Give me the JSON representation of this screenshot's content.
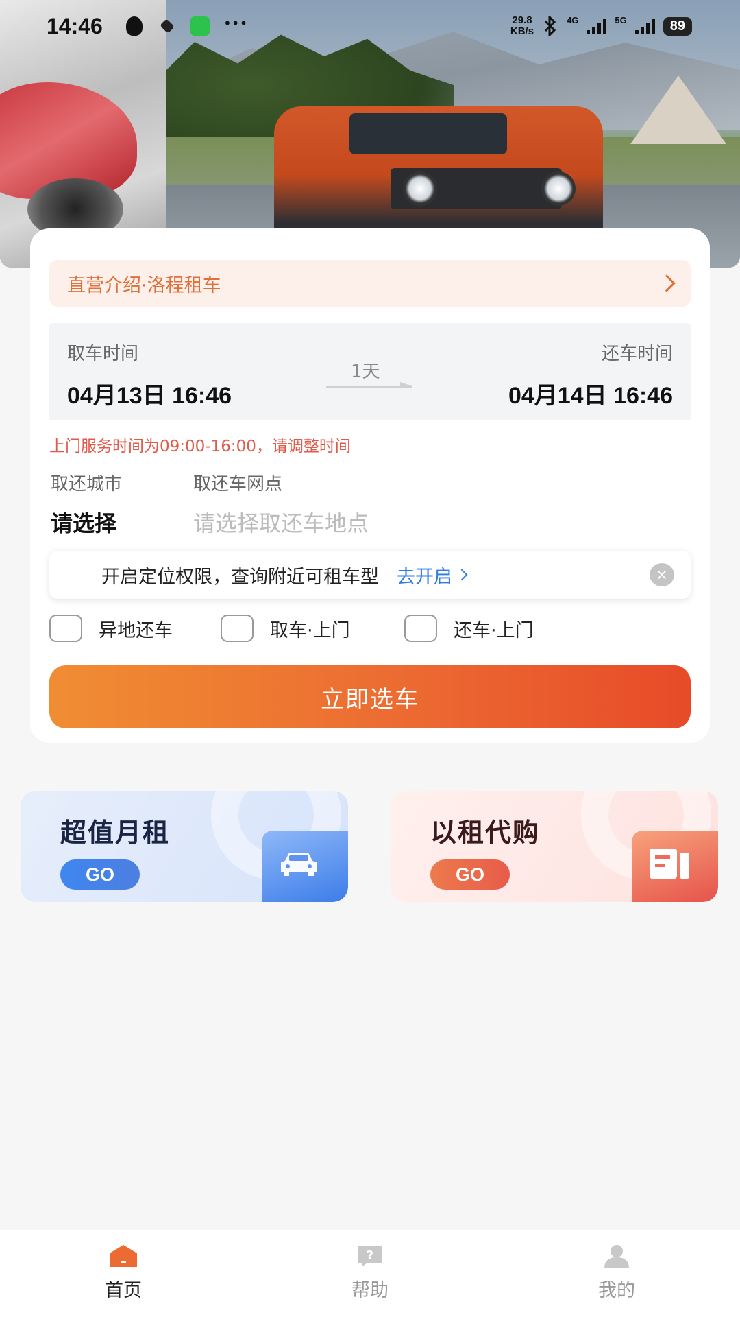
{
  "status_bar": {
    "time": "14:46",
    "speed": "29.8",
    "speed_unit": "KB/s",
    "net1": "4G",
    "net2": "5G",
    "battery": "89",
    "icons": [
      "qq-icon",
      "layers-icon",
      "wechat-icon",
      "more-icon",
      "bluetooth-icon",
      "signal-icon"
    ]
  },
  "intro": {
    "label": "直营介绍·洛程租车"
  },
  "rental_time": {
    "pickup_label": "取车时间",
    "pickup_value": "04月13日 16:46",
    "duration": "1天",
    "return_label": "还车时间",
    "return_value": "04月14日 16:46"
  },
  "notice": "上门服务时间为09:00-16:00，请调整时间",
  "location": {
    "city_label": "取还城市",
    "city_value": "请选择",
    "point_label": "取还车网点",
    "point_placeholder": "请选择取还车地点"
  },
  "location_prompt": {
    "text": "开启定位权限，查询附近可租车型",
    "action": "去开启"
  },
  "options": [
    {
      "label": "异地还车",
      "checked": false
    },
    {
      "label": "取车·上门",
      "checked": false
    },
    {
      "label": "还车·上门",
      "checked": false
    }
  ],
  "cta": {
    "label": "立即选车"
  },
  "promos": [
    {
      "title": "超值月租",
      "go": "GO",
      "icon": "car-icon"
    },
    {
      "title": "以租代购",
      "go": "GO",
      "icon": "document-icon"
    }
  ],
  "nav": [
    {
      "label": "首页",
      "icon": "home-icon",
      "active": true
    },
    {
      "label": "帮助",
      "icon": "help-icon",
      "active": false
    },
    {
      "label": "我的",
      "icon": "user-icon",
      "active": false
    }
  ],
  "colors": {
    "accent": "#ec6b32",
    "link": "#2f7ae5",
    "warning": "#e15a4a"
  }
}
